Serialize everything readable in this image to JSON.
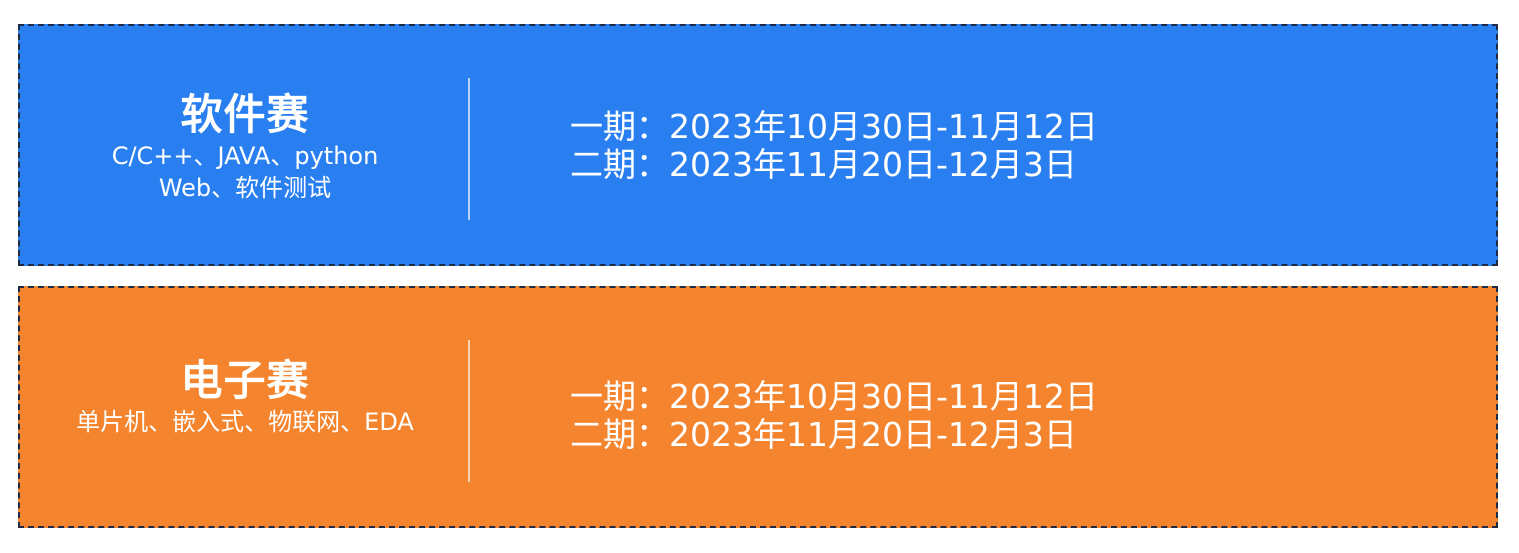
{
  "cards": [
    {
      "title": "软件赛",
      "subtitle_lines": [
        "C/C++、JAVA、python",
        "Web、软件测试"
      ],
      "dates": [
        "一期：2023年10月30日-11月12日",
        "二期：2023年11月20日-12月3日"
      ],
      "color": "#2a7ff0"
    },
    {
      "title": "电子赛",
      "subtitle_lines": [
        "单片机、嵌入式、物联网、EDA"
      ],
      "dates": [
        "一期：2023年10月30日-11月12日",
        "二期：2023年11月20日-12月3日"
      ],
      "color": "#f4842d"
    }
  ]
}
